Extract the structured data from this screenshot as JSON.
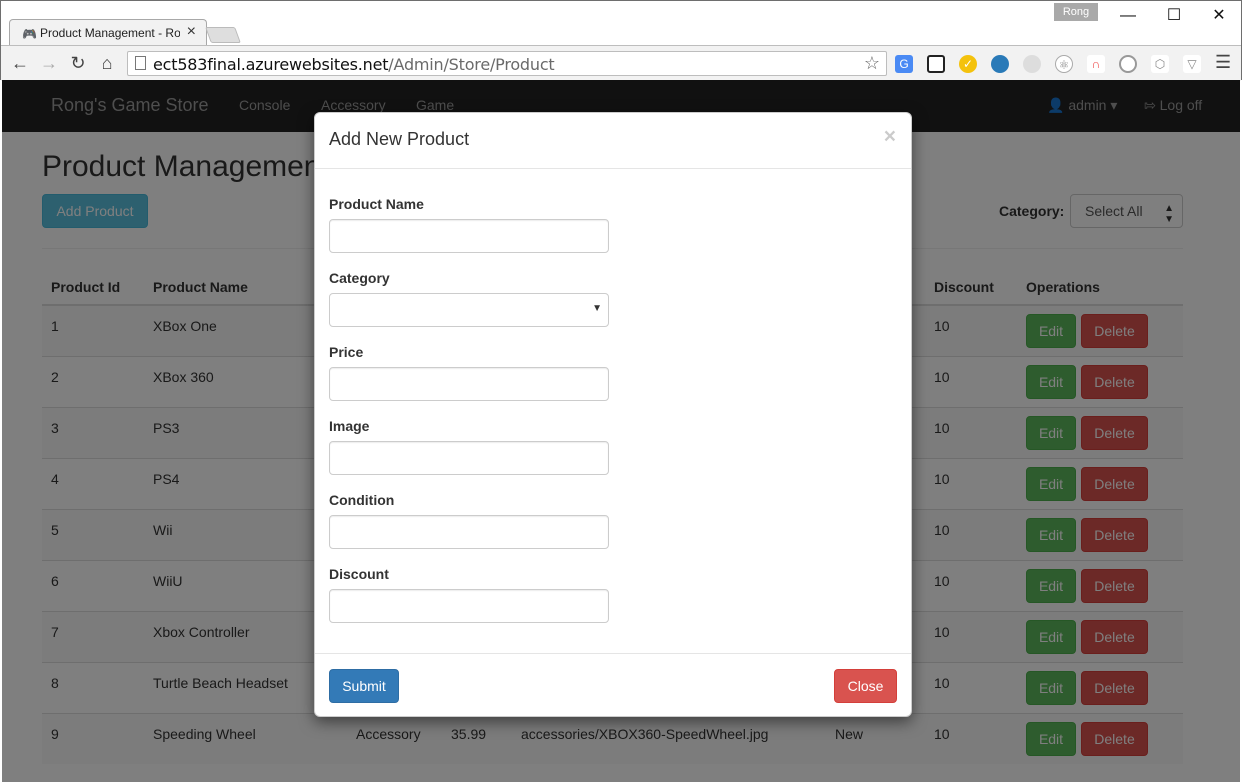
{
  "browser": {
    "tab_title": "Product Management - Rong",
    "profile_label": "Rong",
    "url_host": "ect583final.azurewebsites.net",
    "url_path": "/Admin/Store/Product"
  },
  "navbar": {
    "brand": "Rong's Game Store",
    "links": [
      "Console",
      "Accessory",
      "Game"
    ],
    "user": "admin",
    "logout": "Log off"
  },
  "page": {
    "title": "Product Management",
    "add_button": "Add Product",
    "category_label": "Category:",
    "category_selected": "Select All"
  },
  "table": {
    "headers": {
      "id": "Product Id",
      "name": "Product Name",
      "discount": "Discount",
      "operations": "Operations"
    },
    "rows": [
      {
        "id": "1",
        "name": "XBox One",
        "category": "",
        "price": "",
        "image": "",
        "condition": "",
        "discount": "10"
      },
      {
        "id": "2",
        "name": "XBox 360",
        "category": "",
        "price": "",
        "image": "",
        "condition": "",
        "discount": "10"
      },
      {
        "id": "3",
        "name": "PS3",
        "category": "",
        "price": "",
        "image": "",
        "condition": "",
        "discount": "10"
      },
      {
        "id": "4",
        "name": "PS4",
        "category": "",
        "price": "",
        "image": "",
        "condition": "",
        "discount": "10"
      },
      {
        "id": "5",
        "name": "Wii",
        "category": "",
        "price": "",
        "image": "",
        "condition": "",
        "discount": "10"
      },
      {
        "id": "6",
        "name": "WiiU",
        "category": "",
        "price": "",
        "image": "",
        "condition": "",
        "discount": "10"
      },
      {
        "id": "7",
        "name": "Xbox Controller",
        "category": "",
        "price": "",
        "image": "",
        "condition": "",
        "discount": "10"
      },
      {
        "id": "8",
        "name": "Turtle Beach Headset",
        "category": "",
        "price": "",
        "image": "",
        "condition": "",
        "discount": "10"
      },
      {
        "id": "9",
        "name": "Speeding Wheel",
        "category": "Accessory",
        "price": "35.99",
        "image": "accessories/XBOX360-SpeedWheel.jpg",
        "condition": "New",
        "discount": "10"
      }
    ],
    "edit_label": "Edit",
    "delete_label": "Delete"
  },
  "modal": {
    "title": "Add New Product",
    "close_glyph": "×",
    "fields": {
      "name_label": "Product Name",
      "category_label": "Category",
      "price_label": "Price",
      "image_label": "Image",
      "condition_label": "Condition",
      "discount_label": "Discount"
    },
    "submit_label": "Submit",
    "close_label": "Close"
  }
}
